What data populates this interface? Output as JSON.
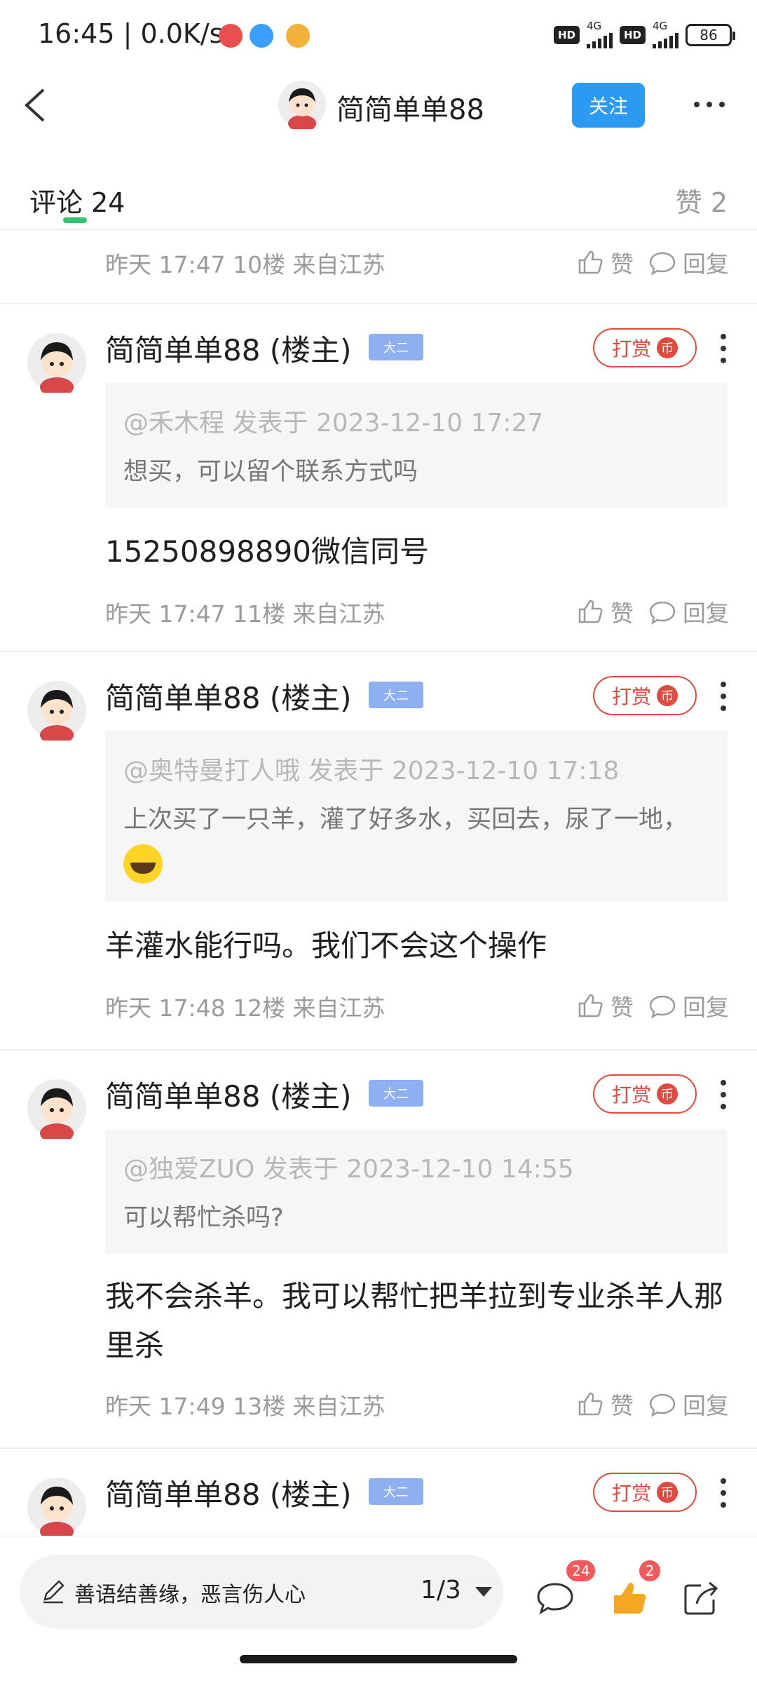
{
  "status_bar": {
    "time": "16:45",
    "speed": "0.0K/s",
    "hd1": "HD",
    "net1": "4G",
    "hd2": "HD",
    "net2": "4G",
    "battery": "86"
  },
  "header": {
    "username": "简简单单88",
    "follow_label": "关注"
  },
  "tabs": {
    "comments_label": "评论",
    "comments_count": "24",
    "likes_label": "赞",
    "likes_count": "2"
  },
  "top_meta": {
    "meta": "昨天 17:47  10楼  来自江苏",
    "like_label": "赞",
    "reply_label": "回复"
  },
  "comments": [
    {
      "name": "简简单单88 (楼主)",
      "badge": "大二",
      "tip_label": "打赏",
      "tip_coin": "币",
      "quote_head": "@禾木程 发表于 2023-12-10 17:27",
      "quote_body": "想买，可以留个联系方式吗",
      "reply": "15250898890微信同号",
      "meta": "昨天 17:47  11楼  来自江苏",
      "like_label": "赞",
      "reply_label": "回复"
    },
    {
      "name": "简简单单88 (楼主)",
      "badge": "大二",
      "tip_label": "打赏",
      "tip_coin": "币",
      "quote_head": "@奥特曼打人哦 发表于 2023-12-10 17:18",
      "quote_body": "上次买了一只羊，灌了好多水，买回去，尿了一地，",
      "reply": "羊灌水能行吗。我们不会这个操作",
      "meta": "昨天 17:48  12楼  来自江苏",
      "like_label": "赞",
      "reply_label": "回复"
    },
    {
      "name": "简简单单88 (楼主)",
      "badge": "大二",
      "tip_label": "打赏",
      "tip_coin": "币",
      "quote_head": "@独爱ZUO 发表于 2023-12-10 14:55",
      "quote_body": "可以帮忙杀吗?",
      "reply": "我不会杀羊。我可以帮忙把羊拉到专业杀羊人那里杀",
      "meta": "昨天 17:49  13楼  来自江苏",
      "like_label": "赞",
      "reply_label": "回复"
    },
    {
      "name": "简简单单88 (楼主)",
      "badge": "大二",
      "tip_label": "打赏",
      "tip_coin": "币"
    }
  ],
  "bottom_bar": {
    "input_placeholder": "善语结善缘，恶言伤人心",
    "page_indicator": "1/3",
    "comment_badge": "24",
    "like_badge": "2"
  }
}
